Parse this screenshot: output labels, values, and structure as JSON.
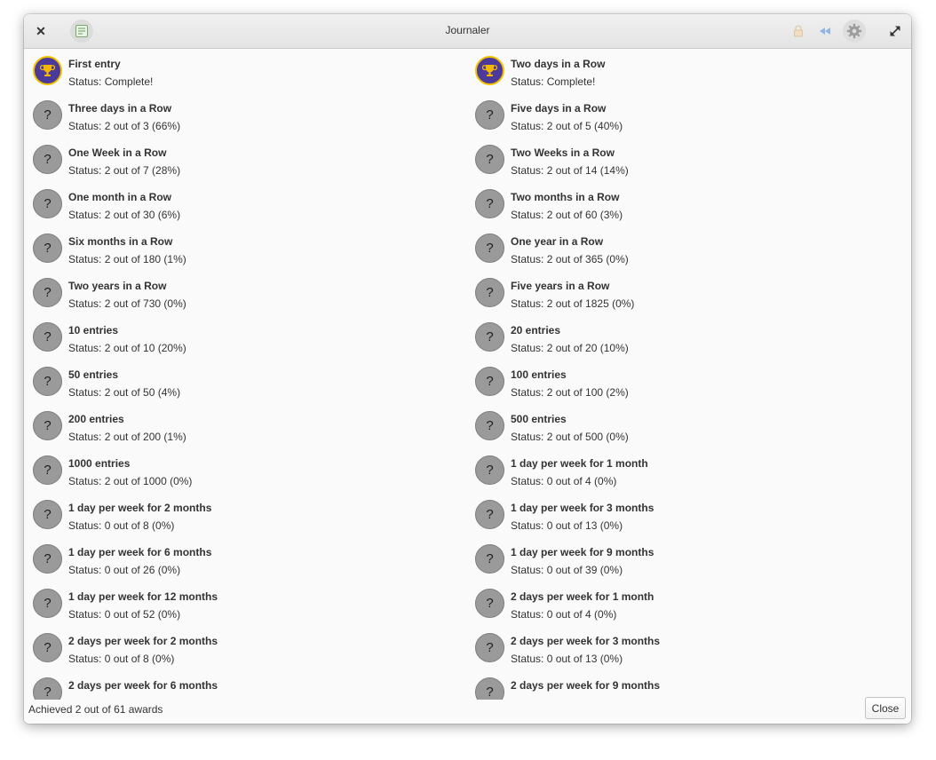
{
  "window": {
    "title": "Journaler"
  },
  "icons": {
    "close": "close-icon",
    "app": "app-icon",
    "lock": "lock-icon",
    "rewind": "rewind-icon",
    "settings": "gear-icon",
    "maximize": "maximize-icon",
    "trophy": "trophy-icon",
    "locked": "question-mark-icon"
  },
  "colors": {
    "trophy_bg": "#4b3a9a",
    "trophy_ring": "#f2c200",
    "trophy_cup": "#f5b800",
    "locked_badge": "#9a9a9a",
    "rewind_accent": "#8fb6e0"
  },
  "awards": [
    {
      "name": "First entry",
      "status": "Status: Complete!",
      "achieved": true
    },
    {
      "name": "Two days in a Row",
      "status": "Status: Complete!",
      "achieved": true
    },
    {
      "name": "Three days in a Row",
      "status": "Status: 2 out of 3 (66%)",
      "achieved": false
    },
    {
      "name": "Five days in a Row",
      "status": "Status: 2 out of 5 (40%)",
      "achieved": false
    },
    {
      "name": "One Week in a Row",
      "status": "Status: 2 out of 7 (28%)",
      "achieved": false
    },
    {
      "name": "Two Weeks in a Row",
      "status": "Status: 2 out of 14 (14%)",
      "achieved": false
    },
    {
      "name": "One month in a Row",
      "status": "Status: 2 out of 30 (6%)",
      "achieved": false
    },
    {
      "name": "Two months in a Row",
      "status": "Status: 2 out of 60 (3%)",
      "achieved": false
    },
    {
      "name": "Six months in a Row",
      "status": "Status: 2 out of 180 (1%)",
      "achieved": false
    },
    {
      "name": "One year in a Row",
      "status": "Status: 2 out of 365 (0%)",
      "achieved": false
    },
    {
      "name": "Two years in a Row",
      "status": "Status: 2 out of 730 (0%)",
      "achieved": false
    },
    {
      "name": "Five years in a Row",
      "status": "Status: 2 out of 1825 (0%)",
      "achieved": false
    },
    {
      "name": "10 entries",
      "status": "Status: 2 out of 10 (20%)",
      "achieved": false
    },
    {
      "name": "20 entries",
      "status": "Status: 2 out of 20 (10%)",
      "achieved": false
    },
    {
      "name": "50 entries",
      "status": "Status: 2 out of 50 (4%)",
      "achieved": false
    },
    {
      "name": "100 entries",
      "status": "Status: 2 out of 100 (2%)",
      "achieved": false
    },
    {
      "name": "200 entries",
      "status": "Status: 2 out of 200 (1%)",
      "achieved": false
    },
    {
      "name": "500 entries",
      "status": "Status: 2 out of 500 (0%)",
      "achieved": false
    },
    {
      "name": "1000 entries",
      "status": "Status: 2 out of 1000 (0%)",
      "achieved": false
    },
    {
      "name": "1 day per week for 1 month",
      "status": "Status: 0 out of 4 (0%)",
      "achieved": false
    },
    {
      "name": "1 day per week for 2 months",
      "status": "Status: 0 out of 8 (0%)",
      "achieved": false
    },
    {
      "name": "1 day per week for 3 months",
      "status": "Status: 0 out of 13 (0%)",
      "achieved": false
    },
    {
      "name": "1 day per week for 6 months",
      "status": "Status: 0 out of 26 (0%)",
      "achieved": false
    },
    {
      "name": "1 day per week for 9 months",
      "status": "Status: 0 out of 39 (0%)",
      "achieved": false
    },
    {
      "name": "1 day per week for 12 months",
      "status": "Status: 0 out of 52 (0%)",
      "achieved": false
    },
    {
      "name": "2 days per week for 1 month",
      "status": "Status: 0 out of 4 (0%)",
      "achieved": false
    },
    {
      "name": "2 days per week for 2 months",
      "status": "Status: 0 out of 8 (0%)",
      "achieved": false
    },
    {
      "name": "2 days per week for 3 months",
      "status": "Status: 0 out of 13 (0%)",
      "achieved": false
    },
    {
      "name": "2 days per week for 6 months",
      "status": "",
      "achieved": false
    },
    {
      "name": "2 days per week for 9 months",
      "status": "",
      "achieved": false
    }
  ],
  "footer": {
    "summary": "Achieved 2 out of 61 awards",
    "close_label": "Close"
  }
}
